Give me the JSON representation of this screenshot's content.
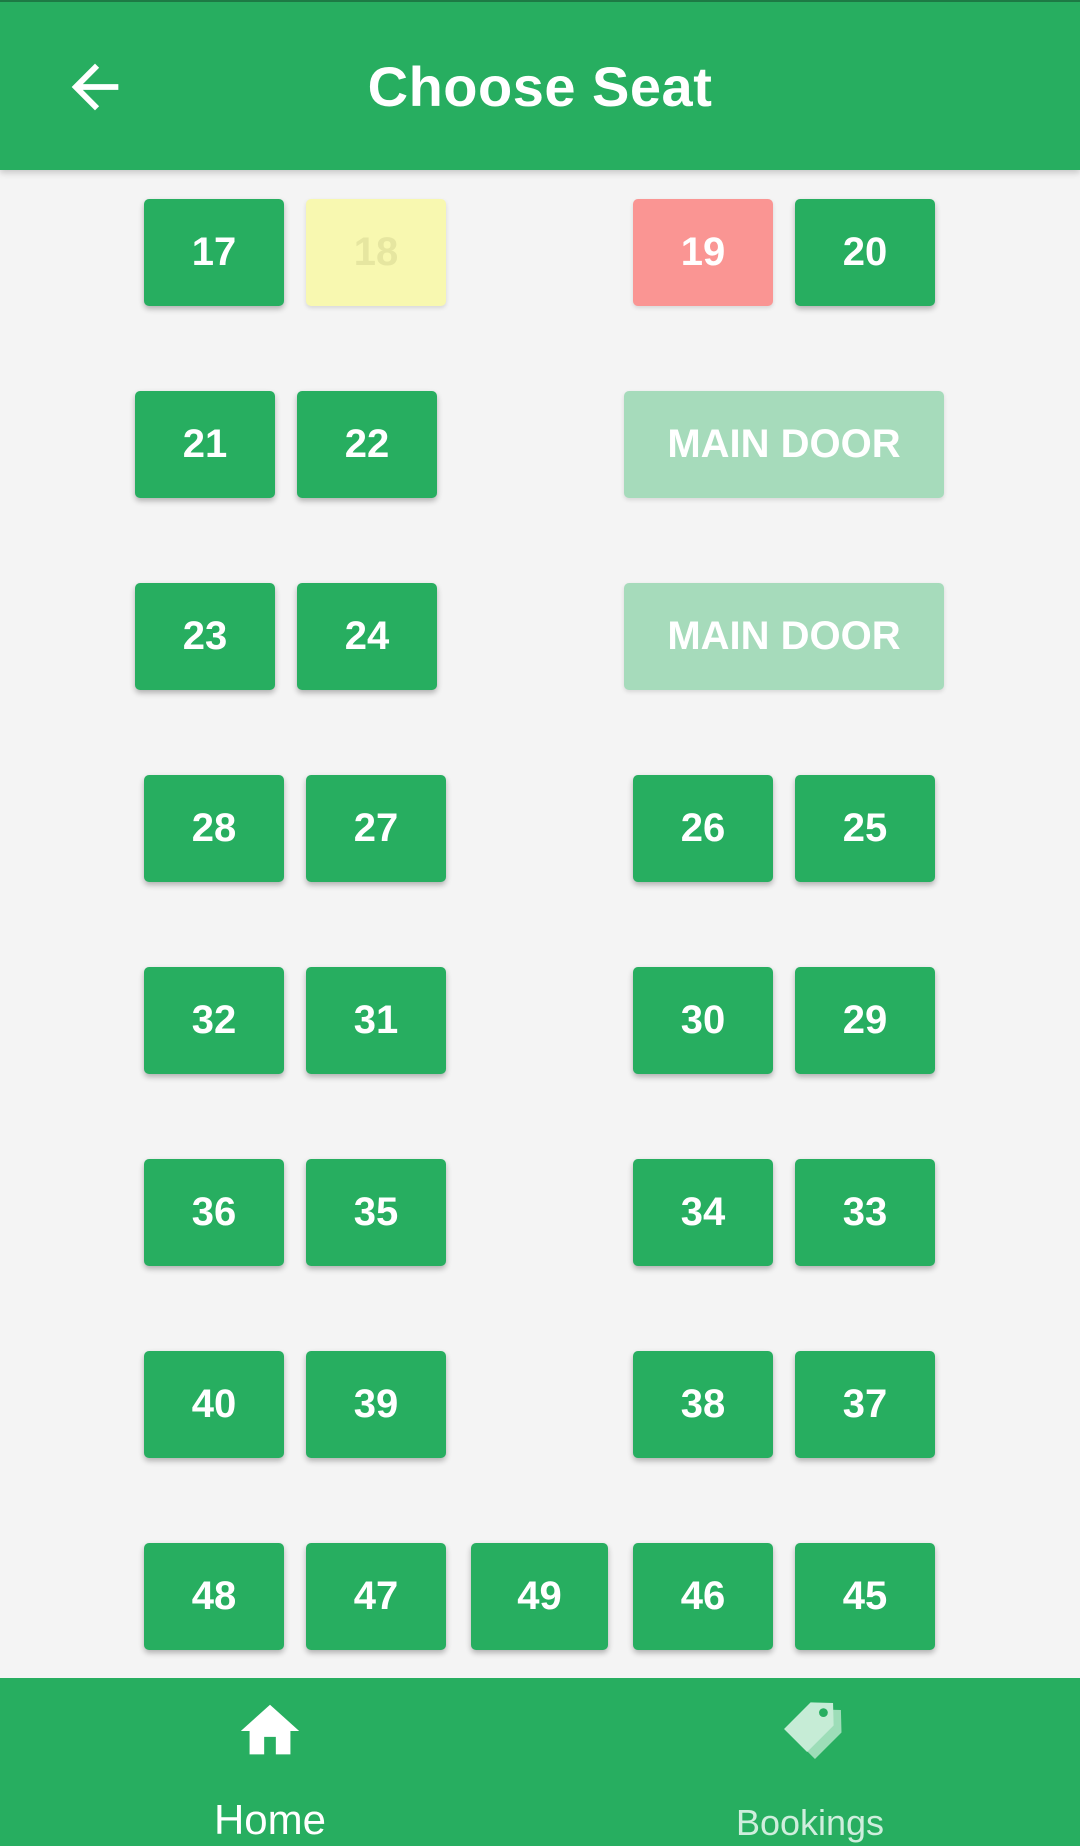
{
  "header": {
    "title": "Choose Seat",
    "back_icon": "arrow-left-icon"
  },
  "seats": {
    "s17": "17",
    "s18": "18",
    "s19": "19",
    "s20": "20",
    "s21": "21",
    "s22": "22",
    "s23": "23",
    "s24": "24",
    "s25": "25",
    "s26": "26",
    "s27": "27",
    "s28": "28",
    "s29": "29",
    "s30": "30",
    "s31": "31",
    "s32": "32",
    "s33": "33",
    "s34": "34",
    "s35": "35",
    "s36": "36",
    "s37": "37",
    "s38": "38",
    "s39": "39",
    "s40": "40",
    "s45": "45",
    "s46": "46",
    "s47": "47",
    "s48": "48",
    "s49": "49"
  },
  "seat_status": {
    "18": "held",
    "19": "booked"
  },
  "door": {
    "label": "MAIN DOOR"
  },
  "bottom_nav": {
    "home": {
      "label": "Home",
      "icon": "home-icon"
    },
    "bookings": {
      "label": "Bookings",
      "icon": "tags-icon"
    }
  },
  "colors": {
    "primary": "#27ae60",
    "held_seat": "#f8f8b0",
    "booked_seat": "#fa9593",
    "door": "#a6dbbb",
    "background": "#f4f4f4"
  }
}
